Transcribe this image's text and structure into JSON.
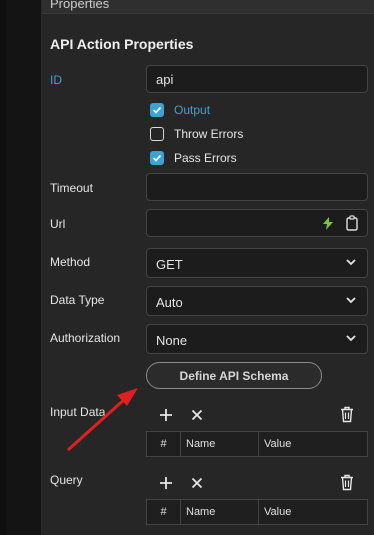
{
  "panel": {
    "header_title": "Properties",
    "section_title": "API Action Properties"
  },
  "form": {
    "id_label": "ID",
    "id_value": "api",
    "checks": [
      {
        "label": "Output",
        "checked": true
      },
      {
        "label": "Throw Errors",
        "checked": false
      },
      {
        "label": "Pass Errors",
        "checked": true
      }
    ],
    "timeout_label": "Timeout",
    "timeout_value": "",
    "url_label": "Url",
    "url_value": "",
    "method_label": "Method",
    "method_value": "GET",
    "datatype_label": "Data Type",
    "datatype_value": "Auto",
    "auth_label": "Authorization",
    "auth_value": "None",
    "schema_button": "Define API Schema"
  },
  "input_data": {
    "label": "Input Data",
    "columns": [
      "#",
      "Name",
      "Value"
    ]
  },
  "query": {
    "label": "Query",
    "columns": [
      "#",
      "Name",
      "Value"
    ]
  },
  "colors": {
    "accent": "#3ea1d8",
    "arrow": "#e02020"
  }
}
